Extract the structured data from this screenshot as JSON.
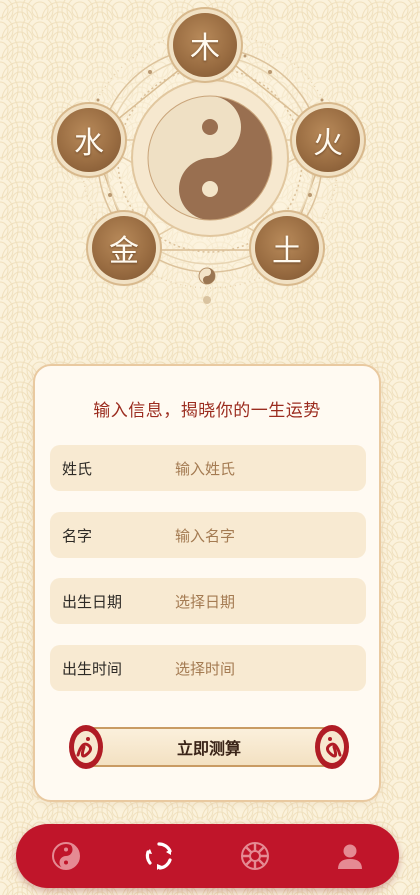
{
  "hero": {
    "elements": [
      {
        "name": "wood",
        "char": "木"
      },
      {
        "name": "fire",
        "char": "火"
      },
      {
        "name": "earth",
        "char": "土"
      },
      {
        "name": "metal",
        "char": "金"
      },
      {
        "name": "water",
        "char": "水"
      }
    ]
  },
  "form": {
    "title": "输入信息，揭晓你的一生运势",
    "fields": [
      {
        "label": "姓氏",
        "placeholder": "输入姓氏"
      },
      {
        "label": "名字",
        "placeholder": "输入名字"
      },
      {
        "label": "出生日期",
        "placeholder": "选择日期"
      },
      {
        "label": "出生时间",
        "placeholder": "选择时间"
      }
    ],
    "submit_label": "立即测算"
  },
  "nav": {
    "items": [
      {
        "icon": "yin-yang-icon",
        "active": false
      },
      {
        "icon": "swirl-icon",
        "active": true
      },
      {
        "icon": "bagua-icon",
        "active": false
      },
      {
        "icon": "profile-icon",
        "active": false
      }
    ]
  },
  "colors": {
    "background": "#fbf2dc",
    "accent_red": "#c0152a",
    "title_red": "#9b2c1f",
    "badge_brown": "#9a6d42",
    "field_bg": "#f8ead2",
    "placeholder": "#a47b52"
  }
}
